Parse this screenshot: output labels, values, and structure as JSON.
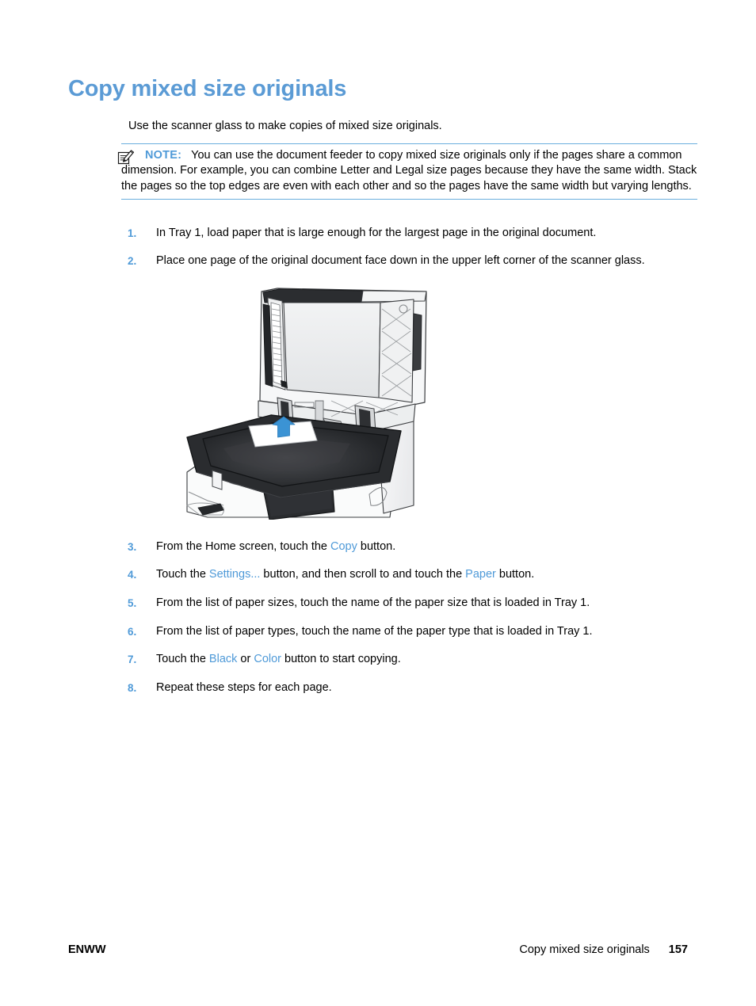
{
  "document": {
    "title": "Copy mixed size originals",
    "intro": "Use the scanner glass to make copies of mixed size originals."
  },
  "note": {
    "icon": "note-pencil-icon",
    "label": "NOTE:",
    "text": "You can use the document feeder to copy mixed size originals only if the pages share a common dimension. For example, you can combine Letter and Legal size pages because they have the same width. Stack the pages so the top edges are even with each other and so the pages have the same width but varying lengths."
  },
  "steps": [
    {
      "number": "1.",
      "text": "In Tray 1, load paper that is large enough for the largest page in the original document."
    },
    {
      "number": "2.",
      "text": "Place one page of the original document face down in the upper left corner of the scanner glass."
    },
    {
      "number": "3.",
      "prefix": "From the Home screen, touch the ",
      "ref1": "Copy",
      "suffix": " button."
    },
    {
      "number": "4.",
      "prefix": "Touch the ",
      "ref1": "Settings...",
      "middle": " button, and then scroll to and touch the ",
      "ref2": "Paper",
      "suffix": " button."
    },
    {
      "number": "5.",
      "text": "From the list of paper sizes, touch the name of the paper size that is loaded in Tray 1."
    },
    {
      "number": "6.",
      "text": "From the list of paper types, touch the name of the paper type that is loaded in Tray 1."
    },
    {
      "number": "7.",
      "prefix": "Touch the ",
      "ref1": "Black",
      "middle": " or ",
      "ref2": "Color",
      "suffix": " button to start copying."
    },
    {
      "number": "8.",
      "text": "Repeat these steps for each page."
    }
  ],
  "figure": {
    "name": "mfp-scanner-glass-illustration",
    "description": "Multifunction printer with scanner lid raised and a sheet of paper placed face down on the scanner glass, blue arrow indicating the upper left corner placement."
  },
  "footer": {
    "left": "ENWW",
    "chapter": "Copy mixed size originals",
    "page_number": "157"
  },
  "colors": {
    "heading_blue": "#5b9bd5",
    "link_blue": "#4f9ad8",
    "rule_blue": "#6aaede",
    "arrow_blue": "#3b93d4",
    "body_black": "#000000"
  }
}
